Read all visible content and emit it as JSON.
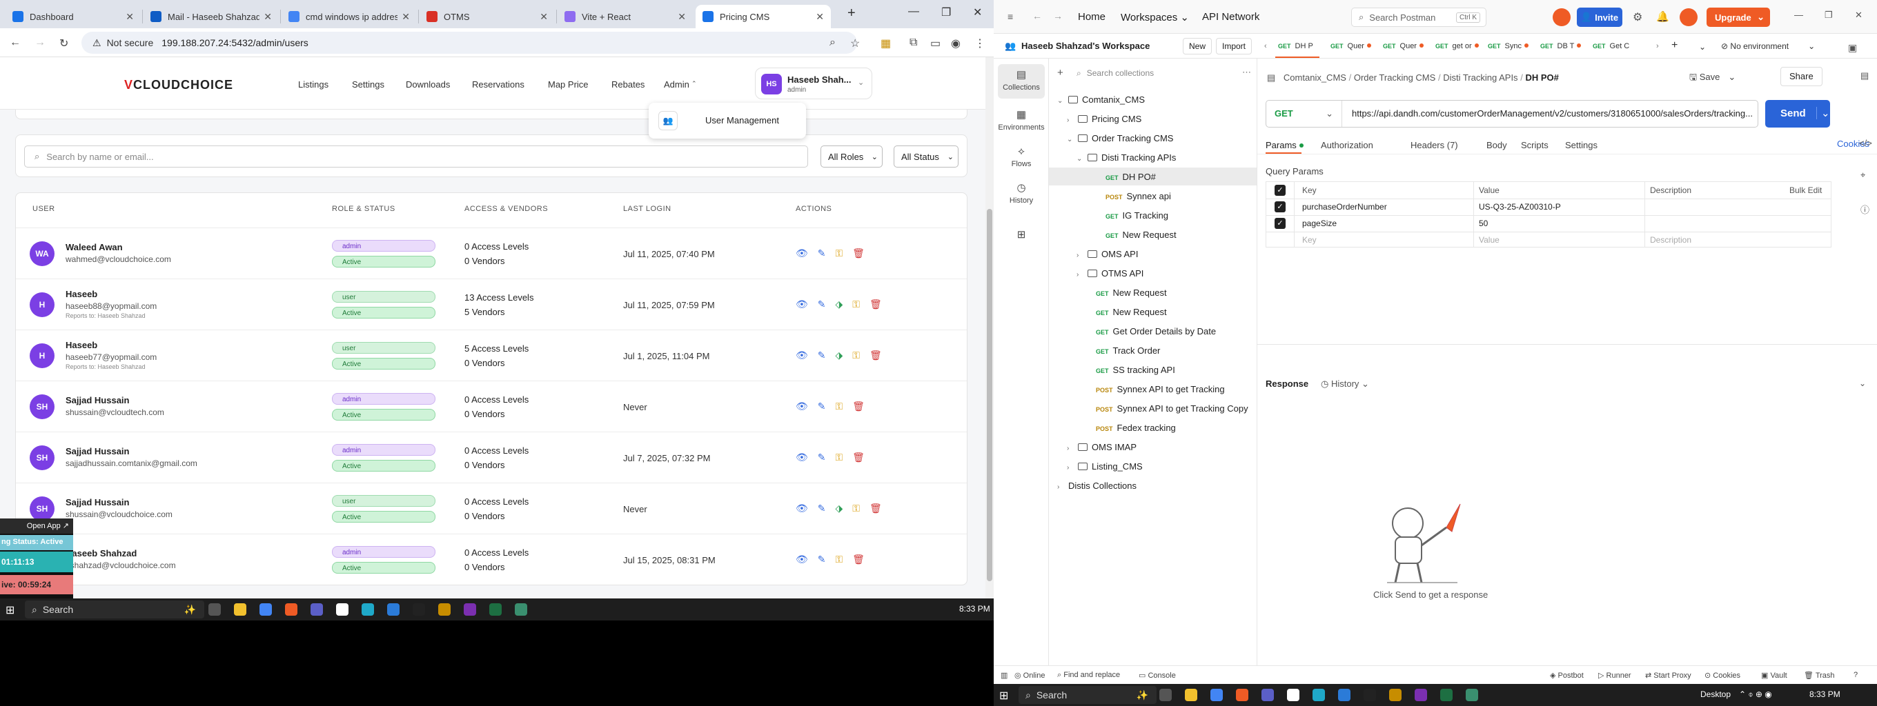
{
  "chrome": {
    "tabs": [
      {
        "title": "Dashboard",
        "color": "#1a73e8"
      },
      {
        "title": "Mail - Haseeb Shahzad",
        "color": "#0f5cc5"
      },
      {
        "title": "cmd windows ip address",
        "color": "#4285f4"
      },
      {
        "title": "OTMS",
        "color": "#d93025"
      },
      {
        "title": "Vite + React",
        "color": "#8e6cf0"
      },
      {
        "title": "Pricing CMS",
        "color": "#1a73e8"
      }
    ],
    "not_secure": "Not secure",
    "url": "199.188.207.24:5432/admin/users"
  },
  "app": {
    "logo_prefix": "V",
    "logo_text": "CLOUDCHOICE",
    "nav": [
      "Listings",
      "Settings",
      "Downloads",
      "Reservations",
      "Map Price",
      "Rebates",
      "Admin"
    ],
    "user_initials": "HS",
    "user_name": "Haseeb Shah...",
    "user_role": "admin",
    "dropdown_item": "User Management",
    "search_placeholder": "Search by name or email...",
    "filter_roles": "All Roles",
    "filter_status": "All Status",
    "columns": [
      "USER",
      "ROLE & STATUS",
      "ACCESS & VENDORS",
      "LAST LOGIN",
      "ACTIONS"
    ],
    "users": [
      {
        "initials": "WA",
        "name": "Waleed Awan",
        "email": "wahmed@vcloudchoice.com",
        "reports": "",
        "role": "admin",
        "status": "Active",
        "access": "0 Access Levels",
        "vendors": "0 Vendors",
        "last_login": "Jul 11, 2025, 07:40 PM",
        "tag": false
      },
      {
        "initials": "H",
        "name": "Haseeb",
        "email": "haseeb88@yopmail.com",
        "reports": "Reports to: Haseeb Shahzad",
        "role": "user",
        "status": "Active",
        "access": "13 Access Levels",
        "vendors": "5 Vendors",
        "last_login": "Jul 11, 2025, 07:59 PM",
        "tag": true
      },
      {
        "initials": "H",
        "name": "Haseeb",
        "email": "haseeb77@yopmail.com",
        "reports": "Reports to: Haseeb Shahzad",
        "role": "user",
        "status": "Active",
        "access": "5 Access Levels",
        "vendors": "0 Vendors",
        "last_login": "Jul 1, 2025, 11:04 PM",
        "tag": true
      },
      {
        "initials": "SH",
        "name": "Sajjad Hussain",
        "email": "shussain@vcloudtech.com",
        "reports": "",
        "role": "admin",
        "status": "Active",
        "access": "0 Access Levels",
        "vendors": "0 Vendors",
        "last_login": "Never",
        "tag": false
      },
      {
        "initials": "SH",
        "name": "Sajjad Hussain",
        "email": "sajjadhussain.comtanix@gmail.com",
        "reports": "",
        "role": "admin",
        "status": "Active",
        "access": "0 Access Levels",
        "vendors": "0 Vendors",
        "last_login": "Jul 7, 2025, 07:32 PM",
        "tag": false
      },
      {
        "initials": "SH",
        "name": "Sajjad Hussain",
        "email": "shussain@vcloudchoice.com",
        "reports": "",
        "role": "user",
        "status": "Active",
        "access": "0 Access Levels",
        "vendors": "0 Vendors",
        "last_login": "Never",
        "tag": true
      },
      {
        "initials": "HS",
        "name": "Haseeb Shahzad",
        "email": "hshahzad@vcloudchoice.com",
        "reports": "",
        "role": "admin",
        "status": "Active",
        "access": "0 Access Levels",
        "vendors": "0 Vendors",
        "last_login": "Jul 15, 2025, 08:31 PM",
        "tag": false
      }
    ]
  },
  "timer": {
    "open_app": "Open App ↗",
    "status": "ng Status: Active",
    "elapsed": "01:11:13",
    "remaining": "ive: 00:59:24"
  },
  "taskbar_left": {
    "search": "Search",
    "time": "8:33 PM"
  },
  "postman": {
    "nav": [
      "Home",
      "Workspaces",
      "API Network"
    ],
    "search": "Search Postman",
    "search_shortcut": "Ctrl K",
    "invite": "Invite",
    "upgrade": "Upgrade",
    "workspace": "Haseeb Shahzad's Workspace",
    "new_btn": "New",
    "import_btn": "Import",
    "rail": [
      "Collections",
      "Environments",
      "Flows",
      "History"
    ],
    "search_collections": "Search collections",
    "tree": [
      {
        "indent": 0,
        "type": "folder",
        "label": "Comtanix_CMS",
        "open": true
      },
      {
        "indent": 1,
        "type": "folder",
        "label": "Pricing CMS",
        "open": false
      },
      {
        "indent": 1,
        "type": "folder",
        "label": "Order Tracking CMS",
        "open": true
      },
      {
        "indent": 2,
        "type": "folder",
        "label": "Disti Tracking APIs",
        "open": true
      },
      {
        "indent": 3,
        "type": "req",
        "method": "GET",
        "label": "DH PO#",
        "selected": true
      },
      {
        "indent": 3,
        "type": "req",
        "method": "POST",
        "label": "Synnex api"
      },
      {
        "indent": 3,
        "type": "req",
        "method": "GET",
        "label": "IG Tracking"
      },
      {
        "indent": 3,
        "type": "req",
        "method": "GET",
        "label": "New Request"
      },
      {
        "indent": 2,
        "type": "folder",
        "label": "OMS API",
        "open": false
      },
      {
        "indent": 2,
        "type": "folder",
        "label": "OTMS API",
        "open": false
      },
      {
        "indent": 2,
        "type": "req",
        "method": "GET",
        "label": "New Request"
      },
      {
        "indent": 2,
        "type": "req",
        "method": "GET",
        "label": "New Request"
      },
      {
        "indent": 2,
        "type": "req",
        "method": "GET",
        "label": "Get Order Details by Date"
      },
      {
        "indent": 2,
        "type": "req",
        "method": "GET",
        "label": "Track Order"
      },
      {
        "indent": 2,
        "type": "req",
        "method": "GET",
        "label": "SS tracking API"
      },
      {
        "indent": 2,
        "type": "req",
        "method": "POST",
        "label": "Synnex API to get Tracking"
      },
      {
        "indent": 2,
        "type": "req",
        "method": "POST",
        "label": "Synnex API to get Tracking Copy"
      },
      {
        "indent": 2,
        "type": "req",
        "method": "POST",
        "label": "Fedex tracking"
      },
      {
        "indent": 1,
        "type": "folder",
        "label": "OMS IMAP",
        "open": false
      },
      {
        "indent": 1,
        "type": "folder",
        "label": "Listing_CMS",
        "open": false
      },
      {
        "indent": 0,
        "type": "root",
        "label": "Distis Collections",
        "open": false
      }
    ],
    "req_tabs": [
      {
        "method": "GET",
        "label": "DH P"
      },
      {
        "method": "GET",
        "label": "Quer"
      },
      {
        "method": "GET",
        "label": "Quer"
      },
      {
        "method": "GET",
        "label": "get or"
      },
      {
        "method": "GET",
        "label": "Sync"
      },
      {
        "method": "GET",
        "label": "DB T"
      },
      {
        "method": "GET",
        "label": "Get C"
      }
    ],
    "environment": "No environment",
    "breadcrumb": [
      "Comtanix_CMS",
      "Order Tracking CMS",
      "Disti Tracking APIs",
      "DH PO#"
    ],
    "save": "Save",
    "share": "Share",
    "method": "GET",
    "url": "https://api.dandh.com/customerOrderManagement/v2/customers/3180651000/salesOrders/tracking...",
    "send": "Send",
    "subtabs": [
      "Params",
      "Authorization",
      "Headers (7)",
      "Body",
      "Scripts",
      "Settings"
    ],
    "cookies": "Cookies",
    "query_params_title": "Query Params",
    "param_headers": [
      "Key",
      "Value",
      "Description",
      "Bulk Edit"
    ],
    "params": [
      {
        "key": "purchaseOrderNumber",
        "value": "US-Q3-25-AZ00310-P"
      },
      {
        "key": "pageSize",
        "value": "50"
      }
    ],
    "placeholder_key": "Key",
    "placeholder_value": "Value",
    "placeholder_desc": "Description",
    "response_title": "Response",
    "history": "History",
    "empty_msg": "Click Send to get a response",
    "status": [
      "Online",
      "Find and replace",
      "Console"
    ],
    "status_right": [
      "Postbot",
      "Runner",
      "Start Proxy",
      "Cookies",
      "Vault",
      "Trash"
    ]
  },
  "taskbar_right": {
    "search": "Search",
    "desktop": "Desktop",
    "time": "8:33 PM"
  }
}
